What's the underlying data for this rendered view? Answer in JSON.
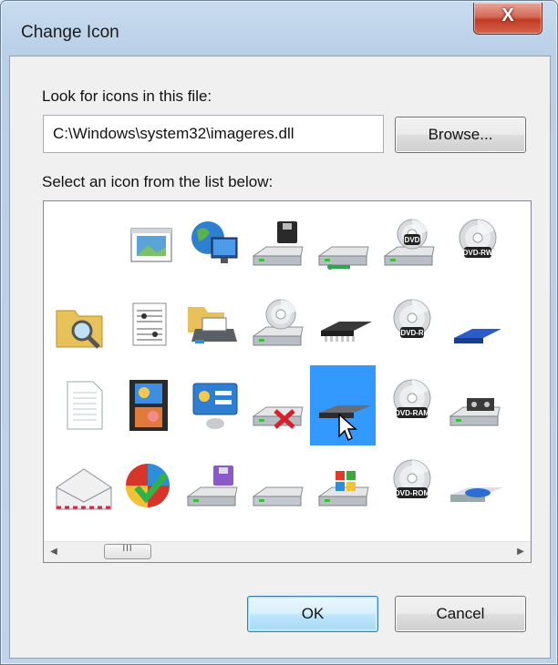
{
  "window": {
    "title": "Change Icon",
    "close_glyph": "X"
  },
  "file_section": {
    "label": "Look for icons in this file:",
    "path_value": "C:\\Windows\\system32\\imageres.dll",
    "browse_label": "Browse..."
  },
  "list_section": {
    "label": "Select an icon from the list below:",
    "selected_index": 20
  },
  "icons": [
    {
      "name": "blank-icon"
    },
    {
      "name": "picture-window-icon"
    },
    {
      "name": "network-globe-computer-icon"
    },
    {
      "name": "floppy-drive-icon"
    },
    {
      "name": "network-drive-icon"
    },
    {
      "name": "dvd-drive-icon",
      "badge": "DVD"
    },
    {
      "name": "dvd-rw-disc-icon",
      "badge": "DVD-RW"
    },
    {
      "name": "globe-partial-icon"
    },
    {
      "name": "folder-search-icon"
    },
    {
      "name": "music-sheet-icon"
    },
    {
      "name": "printer-folder-icon"
    },
    {
      "name": "cd-drive-icon"
    },
    {
      "name": "memory-chip-icon"
    },
    {
      "name": "dvd-r-disc-icon",
      "badge": "DVD-R"
    },
    {
      "name": "blue-drive-icon"
    },
    {
      "name": "camcorder-icon"
    },
    {
      "name": "document-icon"
    },
    {
      "name": "film-strip-icon"
    },
    {
      "name": "control-panel-icon"
    },
    {
      "name": "network-drive-disconnected-icon"
    },
    {
      "name": "flash-drive-icon"
    },
    {
      "name": "dvd-ram-disc-icon",
      "badge": "DVD-RAM"
    },
    {
      "name": "tape-drive-icon"
    },
    {
      "name": "partial-item-icon"
    },
    {
      "name": "mail-envelope-icon"
    },
    {
      "name": "security-shield-check-icon"
    },
    {
      "name": "floppy-disk-drive-icon"
    },
    {
      "name": "hard-drive-icon"
    },
    {
      "name": "windows-drive-icon"
    },
    {
      "name": "dvd-rom-disc-icon",
      "badge": "DVD-ROM"
    },
    {
      "name": "disc-in-drive-icon"
    },
    {
      "name": "floppy-partial-icon"
    }
  ],
  "scrollbar": {
    "thumb_grip": "III"
  },
  "buttons": {
    "ok": "OK",
    "cancel": "Cancel"
  },
  "colors": {
    "selection": "#3399ff",
    "close_button": "#c94a35"
  }
}
